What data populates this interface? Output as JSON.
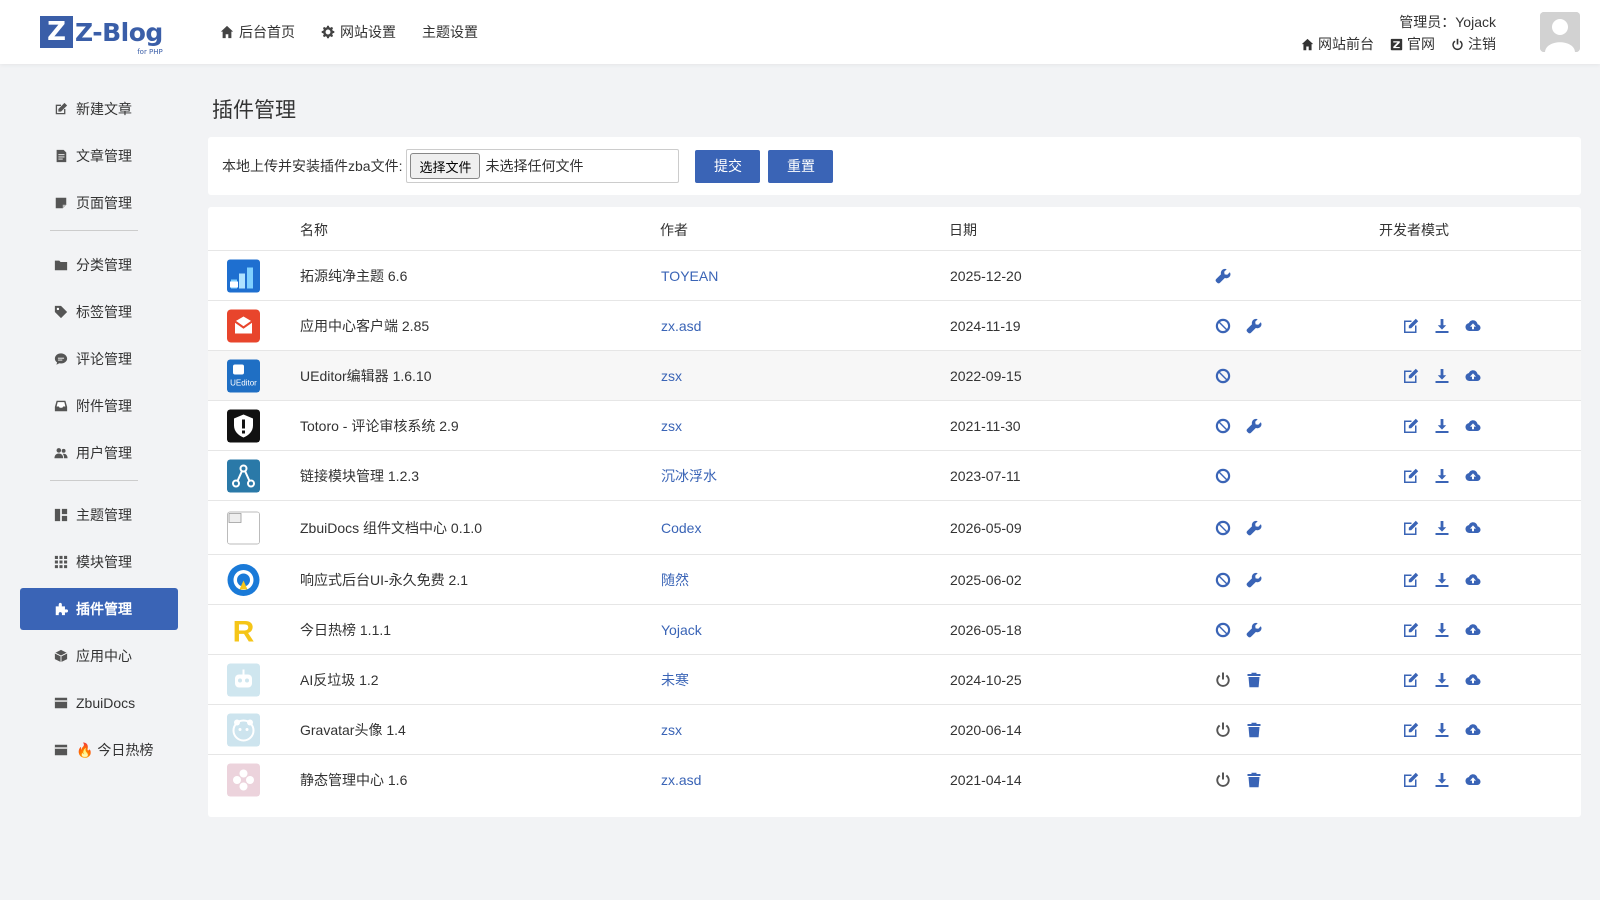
{
  "header": {
    "logo_letter": "Z",
    "logo_text": "Z-Blog",
    "logo_sub": "for PHP",
    "nav": [
      {
        "label": "后台首页",
        "icon": "home-icon"
      },
      {
        "label": "网站设置",
        "icon": "gear-icon"
      },
      {
        "label": "主题设置",
        "icon": ""
      }
    ],
    "user": {
      "name_text": "管理员：Yojack",
      "links": [
        {
          "label": "网站前台",
          "icon": "home-icon"
        },
        {
          "label": "官网",
          "icon": "zblog-icon"
        },
        {
          "label": "注销",
          "icon": "power-icon"
        }
      ]
    }
  },
  "sidebar": {
    "items": [
      {
        "label": "新建文章",
        "icon": "edit-icon"
      },
      {
        "label": "文章管理",
        "icon": "article-icon"
      },
      {
        "label": "页面管理",
        "icon": "page-icon"
      },
      {
        "label": "分类管理",
        "icon": "folder-icon"
      },
      {
        "label": "标签管理",
        "icon": "tag-icon"
      },
      {
        "label": "评论管理",
        "icon": "comment-icon"
      },
      {
        "label": "附件管理",
        "icon": "inbox-icon"
      },
      {
        "label": "用户管理",
        "icon": "users-icon"
      },
      {
        "label": "主题管理",
        "icon": "layout-icon"
      },
      {
        "label": "模块管理",
        "icon": "grid-icon"
      },
      {
        "label": "插件管理",
        "icon": "puzzle-icon",
        "active": true
      },
      {
        "label": "应用中心",
        "icon": "box-icon"
      },
      {
        "label": "ZbuiDocs",
        "icon": "card-icon"
      },
      {
        "label": "🔥 今日热榜",
        "icon": "card-icon"
      }
    ]
  },
  "main": {
    "title": "插件管理",
    "upload": {
      "label": "本地上传并安装插件zba文件:",
      "file_button": "选择文件",
      "file_status": "未选择任何文件",
      "submit": "提交",
      "reset": "重置"
    },
    "table": {
      "headers": {
        "name": "名称",
        "author": "作者",
        "date": "日期",
        "dev": "开发者模式"
      },
      "rows": [
        {
          "name": "拓源纯净主题 6.6",
          "author": "TOYEAN",
          "date": "2025-12-20",
          "icon_color": "#1e6fd0",
          "status": "theme",
          "actions": [
            "wrench"
          ],
          "dev": false
        },
        {
          "name": "应用中心客户端 2.85",
          "author": "zx.asd",
          "date": "2024-11-19",
          "icon_color": "#e8452c",
          "status": "enabled",
          "actions": [
            "disable",
            "wrench"
          ],
          "dev": true
        },
        {
          "name": "UEditor编辑器 1.6.10",
          "author": "zsx",
          "date": "2022-09-15",
          "icon_color": "#1f6fc4",
          "icon_text": "UEditor",
          "status": "enabled",
          "actions": [
            "disable"
          ],
          "dev": true
        },
        {
          "name": "Totoro - 评论审核系统 2.9",
          "author": "zsx",
          "date": "2021-11-30",
          "icon_color": "#111111",
          "status": "enabled",
          "actions": [
            "disable",
            "wrench"
          ],
          "dev": true
        },
        {
          "name": "链接模块管理 1.2.3",
          "author": "沉冰浮水",
          "date": "2023-07-11",
          "icon_color": "#2a79a8",
          "status": "enabled",
          "actions": [
            "disable"
          ],
          "dev": true
        },
        {
          "name": "ZbuiDocs 组件文档中心 0.1.0",
          "author": "Codex",
          "date": "2026-05-09",
          "icon_color": "#ffffff",
          "status": "enabled",
          "actions": [
            "disable",
            "wrench"
          ],
          "dev": true
        },
        {
          "name": "响应式后台UI-永久免费 2.1",
          "author": "随然",
          "date": "2025-06-02",
          "icon_color": "#1a7ad8",
          "status": "enabled",
          "actions": [
            "disable",
            "wrench"
          ],
          "dev": true
        },
        {
          "name": "今日热榜 1.1.1",
          "author": "Yojack",
          "date": "2026-05-18",
          "icon_color": "#f5c518",
          "icon_text": "R",
          "status": "enabled",
          "actions": [
            "disable",
            "wrench"
          ],
          "dev": true
        },
        {
          "name": "AI反垃圾 1.2",
          "author": "未寒",
          "date": "2024-10-25",
          "icon_color": "#cfe6ef",
          "status": "disabled",
          "actions": [
            "power",
            "trash"
          ],
          "dev": true
        },
        {
          "name": "Gravatar头像 1.4",
          "author": "zsx",
          "date": "2020-06-14",
          "icon_color": "#cde4ee",
          "status": "disabled",
          "actions": [
            "power",
            "trash"
          ],
          "dev": true
        },
        {
          "name": "静态管理中心 1.6",
          "author": "zx.asd",
          "date": "2021-04-14",
          "icon_color": "#ecd3dc",
          "status": "disabled",
          "actions": [
            "power",
            "trash"
          ],
          "dev": true
        }
      ]
    }
  },
  "colors": {
    "accent": "#3a64b6",
    "brand": "#3a5ea8",
    "background": "#f2f3f5"
  }
}
